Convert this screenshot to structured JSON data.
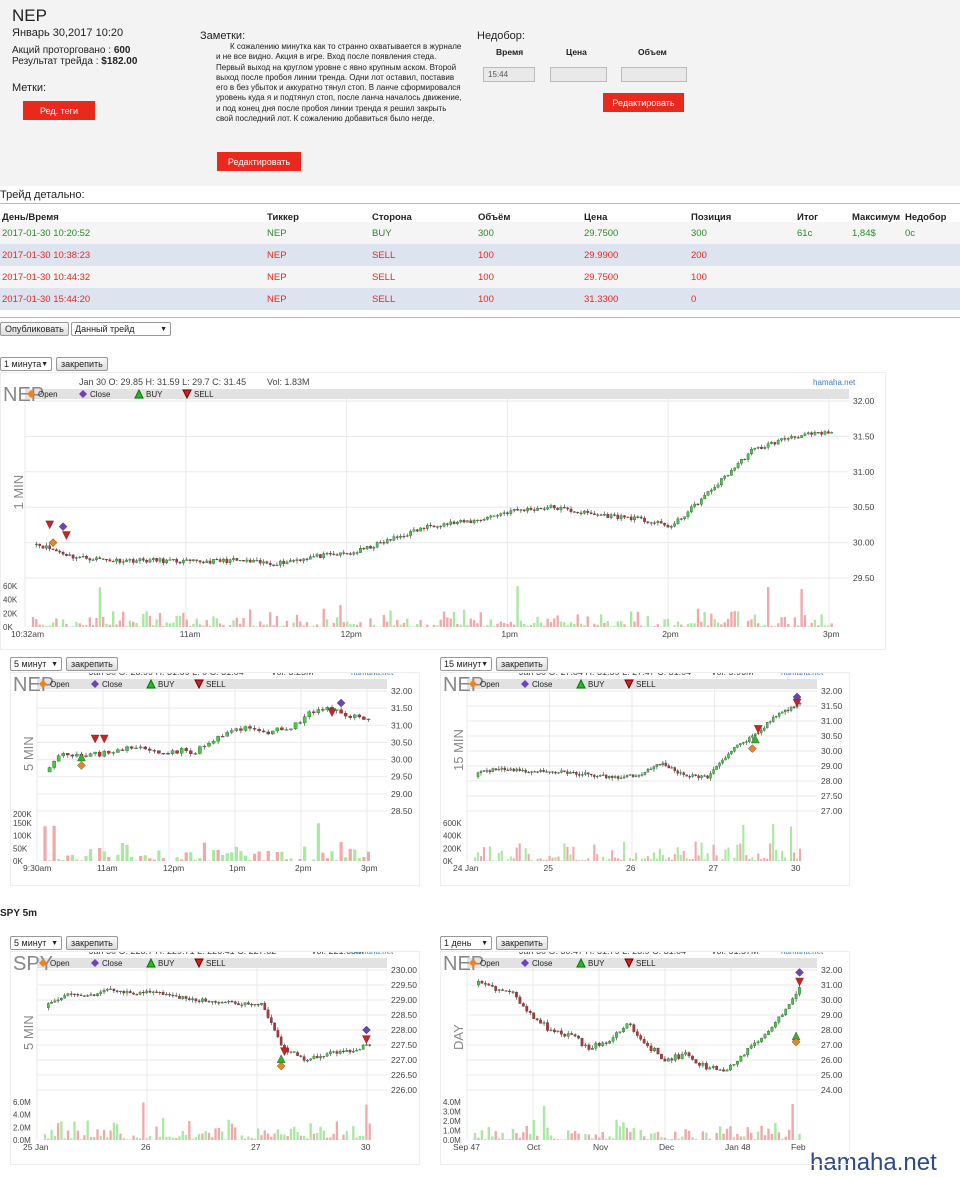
{
  "trade": {
    "ticker": "NEP",
    "datetime": "Январь 30,2017 10:20",
    "shares_label": "Акций проторговано :",
    "shares_value": "600",
    "result_label": "Результат трейда :",
    "result_value": "$182.00",
    "tags_label": "Метки:",
    "tags_btn": "Ред. теги"
  },
  "notes": {
    "label": "Заметки:",
    "text": "К сожалению минутка как то странно охватывается в журнале и не все видно. Акция в игре. Вход после появления стеда. Первый выход на круглом уровне с явно крупным аском. Второй выход после пробоя линии тренда. Одни лот оставил, поставив его в без убыток и аккуратно тянул стоп. В ланче сформировался уровень куда я и подтянул стоп, после ланча началось движение, и под конец дня после пробоя линии тренда я решил закрыть свой последний лот. К сожалению добавиться было негде.",
    "edit_btn": "Редактировать"
  },
  "shortfall": {
    "label": "Недобор:",
    "col_time": "Время",
    "col_price": "Цена",
    "col_volume": "Объем",
    "time_value": "15:44",
    "price_value": "",
    "volume_value": "",
    "edit_btn": "Редактировать"
  },
  "detail": {
    "title": "Трейд детально:",
    "headers": [
      "День/Время",
      "Тиккер",
      "Сторона",
      "Объём",
      "Цена",
      "Позиция",
      "Итог",
      "Максимум",
      "Недобор"
    ],
    "rows": [
      {
        "dt": "2017-01-30 10:20:52",
        "ticker": "NEP",
        "side": "BUY",
        "vol": "300",
        "price": "29.7500",
        "pos": "300",
        "result": "61c",
        "max": "1,84$",
        "short": "0c",
        "color": "#2a8a2a"
      },
      {
        "dt": "2017-01-30 10:38:23",
        "ticker": "NEP",
        "side": "SELL",
        "vol": "100",
        "price": "29.9900",
        "pos": "200",
        "result": "",
        "max": "",
        "short": "",
        "color": "#e8291c"
      },
      {
        "dt": "2017-01-30 10:44:32",
        "ticker": "NEP",
        "side": "SELL",
        "vol": "100",
        "price": "29.7500",
        "pos": "100",
        "result": "",
        "max": "",
        "short": "",
        "color": "#e8291c"
      },
      {
        "dt": "2017-01-30 15:44:20",
        "ticker": "NEP",
        "side": "SELL",
        "vol": "100",
        "price": "31.3300",
        "pos": "0",
        "result": "",
        "max": "",
        "short": "",
        "color": "#e8291c"
      }
    ]
  },
  "controls": {
    "publish_btn": "Опубликовать",
    "select_value": "Данный трейд"
  },
  "legend": {
    "open": "Open",
    "close": "Close",
    "buy": "BUY",
    "sell": "SELL"
  },
  "charts": {
    "c1": {
      "period": "1 минута",
      "pin": "закрепить",
      "symbol": "NEP",
      "side_label": "1 MIN",
      "ohlc": "Jan 30 O: 29.85 H: 31.59 L: 29.7 C: 31.45",
      "vol": "Vol: 1.83M",
      "brand": "hamaha.net",
      "yticks": [
        "32.00",
        "31.50",
        "31.00",
        "30.50",
        "30.00",
        "29.50"
      ],
      "vticks": [
        "60K",
        "40K",
        "20K",
        "0K"
      ],
      "xticks": [
        "10:32am",
        "11am",
        "12pm",
        "1pm",
        "2pm",
        "3pm"
      ]
    },
    "c2": {
      "period": "5 минут",
      "pin": "закрепить",
      "symbol": "NEP",
      "side_label": "5 MIN",
      "ohlc": "Jan 30 O: 28.99 H: 31.59 L: 0 C: 31.04",
      "vol": "Vol: 3.25M",
      "brand": "hamaha.net",
      "yticks": [
        "32.00",
        "31.50",
        "31.00",
        "30.50",
        "30.00",
        "29.50",
        "29.00",
        "28.50"
      ],
      "vticks": [
        "150K",
        "100K",
        "50K",
        "0K"
      ],
      "vticks_top": "200K",
      "xticks": [
        "9:30am",
        "11am",
        "12pm",
        "1pm",
        "2pm",
        "3pm"
      ]
    },
    "c3": {
      "period": "15 минут",
      "pin": "закрепить",
      "symbol": "NEP",
      "side_label": "15 MIN",
      "ohlc": "Jan 30 O: 27.84 H: 31.59 L: 27.47 C: 31.04",
      "vol": "Vol: 5.96M",
      "brand": "hamaha.net",
      "yticks": [
        "32.00",
        "31.50",
        "31.00",
        "30.50",
        "30.00",
        "29.00",
        "28.00",
        "27.50",
        "27.00"
      ],
      "vticks": [
        "600K",
        "400K",
        "200K",
        "0K"
      ],
      "xticks": [
        "24 Jan",
        "25",
        "26",
        "27",
        "30"
      ]
    },
    "c4": {
      "period": "5 минут",
      "pin": "закрепить",
      "symbol": "SPY",
      "side_label": "5 MIN",
      "ohlc": "Jan 30 O: 228.7 H: 229.71 L: 226.41 C: 227.62",
      "vol": "Vol: 221.68M",
      "brand": "hamaha.net",
      "yticks": [
        "230.00",
        "229.50",
        "229.00",
        "228.50",
        "228.00",
        "227.50",
        "227.00",
        "226.50",
        "226.00"
      ],
      "vticks": [
        "6.0M",
        "4.0M",
        "2.0M",
        "0.0M"
      ],
      "xticks": [
        "25 Jan",
        "26",
        "27",
        "30"
      ]
    },
    "c5": {
      "period": "1 день",
      "pin": "закрепить",
      "symbol": "NEP",
      "side_label": "DAY",
      "ohlc": "Jan 30 O: 30.47 H: 31.79 L: 23.9 C: 31.04",
      "vol": "Vol: 51.57M",
      "brand": "hamaha.net",
      "yticks": [
        "32.00",
        "31.00",
        "30.00",
        "29.00",
        "28.00",
        "27.00",
        "26.00",
        "25.00",
        "24.00"
      ],
      "vticks": [
        "4.0M",
        "3.0M",
        "2.0M",
        "1.0M",
        "0.0M"
      ],
      "xticks": [
        "Sep 47",
        "Oct",
        "Nov",
        "Dec",
        "Jan 48",
        "Feb"
      ]
    }
  },
  "spy_title": "SPY 5m",
  "footer_brand": "hamaha.net"
}
